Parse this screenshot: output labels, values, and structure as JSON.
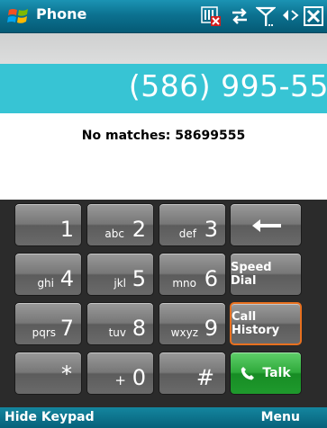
{
  "titlebar": {
    "title": "Phone",
    "icons": [
      "windows-start-icon",
      "sim-missing-icon",
      "connectivity-icon",
      "signal-icon",
      "volume-icon",
      "close-icon"
    ]
  },
  "display": {
    "number": "(586) 995-55",
    "match_text": "No matches: 58699555"
  },
  "keypad": {
    "keys": [
      {
        "digit": "1",
        "letters": ""
      },
      {
        "digit": "2",
        "letters": "abc"
      },
      {
        "digit": "3",
        "letters": "def"
      },
      {
        "digit": "4",
        "letters": "ghi"
      },
      {
        "digit": "5",
        "letters": "jkl"
      },
      {
        "digit": "6",
        "letters": "mno"
      },
      {
        "digit": "7",
        "letters": "pqrs"
      },
      {
        "digit": "8",
        "letters": "tuv"
      },
      {
        "digit": "9",
        "letters": "wxyz"
      },
      {
        "digit": "*",
        "letters": ""
      },
      {
        "digit": "0",
        "letters": "+"
      },
      {
        "digit": "#",
        "letters": ""
      }
    ],
    "backspace_icon": "backspace-arrow-icon",
    "speed_dial": "Speed Dial",
    "call_history": "Call History",
    "talk": "Talk"
  },
  "softkeys": {
    "left": "Hide Keypad",
    "right": "Menu"
  },
  "colors": {
    "titlebar": "#0c7291",
    "number_bar": "#37c4d4",
    "keypad_bg": "#2b2b2b",
    "key": "#777777",
    "talk_key": "#2faa3b",
    "highlight_border": "#e8701f"
  }
}
